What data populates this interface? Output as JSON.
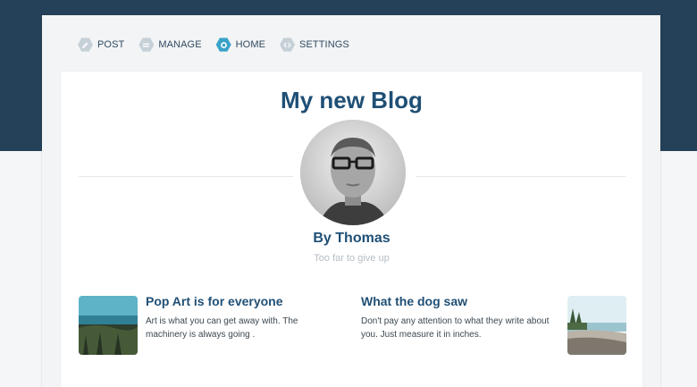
{
  "nav": {
    "items": [
      {
        "label": "POST",
        "icon": "pencil-icon",
        "active": false
      },
      {
        "label": "MANAGE",
        "icon": "menu-icon",
        "active": false
      },
      {
        "label": "HOME",
        "icon": "ring-icon",
        "active": true
      },
      {
        "label": "SETTINGS",
        "icon": "code-icon",
        "active": false
      }
    ]
  },
  "blog": {
    "title": "My new Blog",
    "author": "By Thomas",
    "tagline": "Too far to give up"
  },
  "posts": [
    {
      "title": "Pop Art is for everyone",
      "text": "Art is what you can get away with. The machinery is always going ."
    },
    {
      "title": "What the dog saw",
      "text": "Don't pay any attention to what they write about you. Just measure it in inches."
    }
  ],
  "colors": {
    "header_band": "#25415a",
    "accent": "#3aa2c9",
    "title_text": "#1f4f75"
  }
}
